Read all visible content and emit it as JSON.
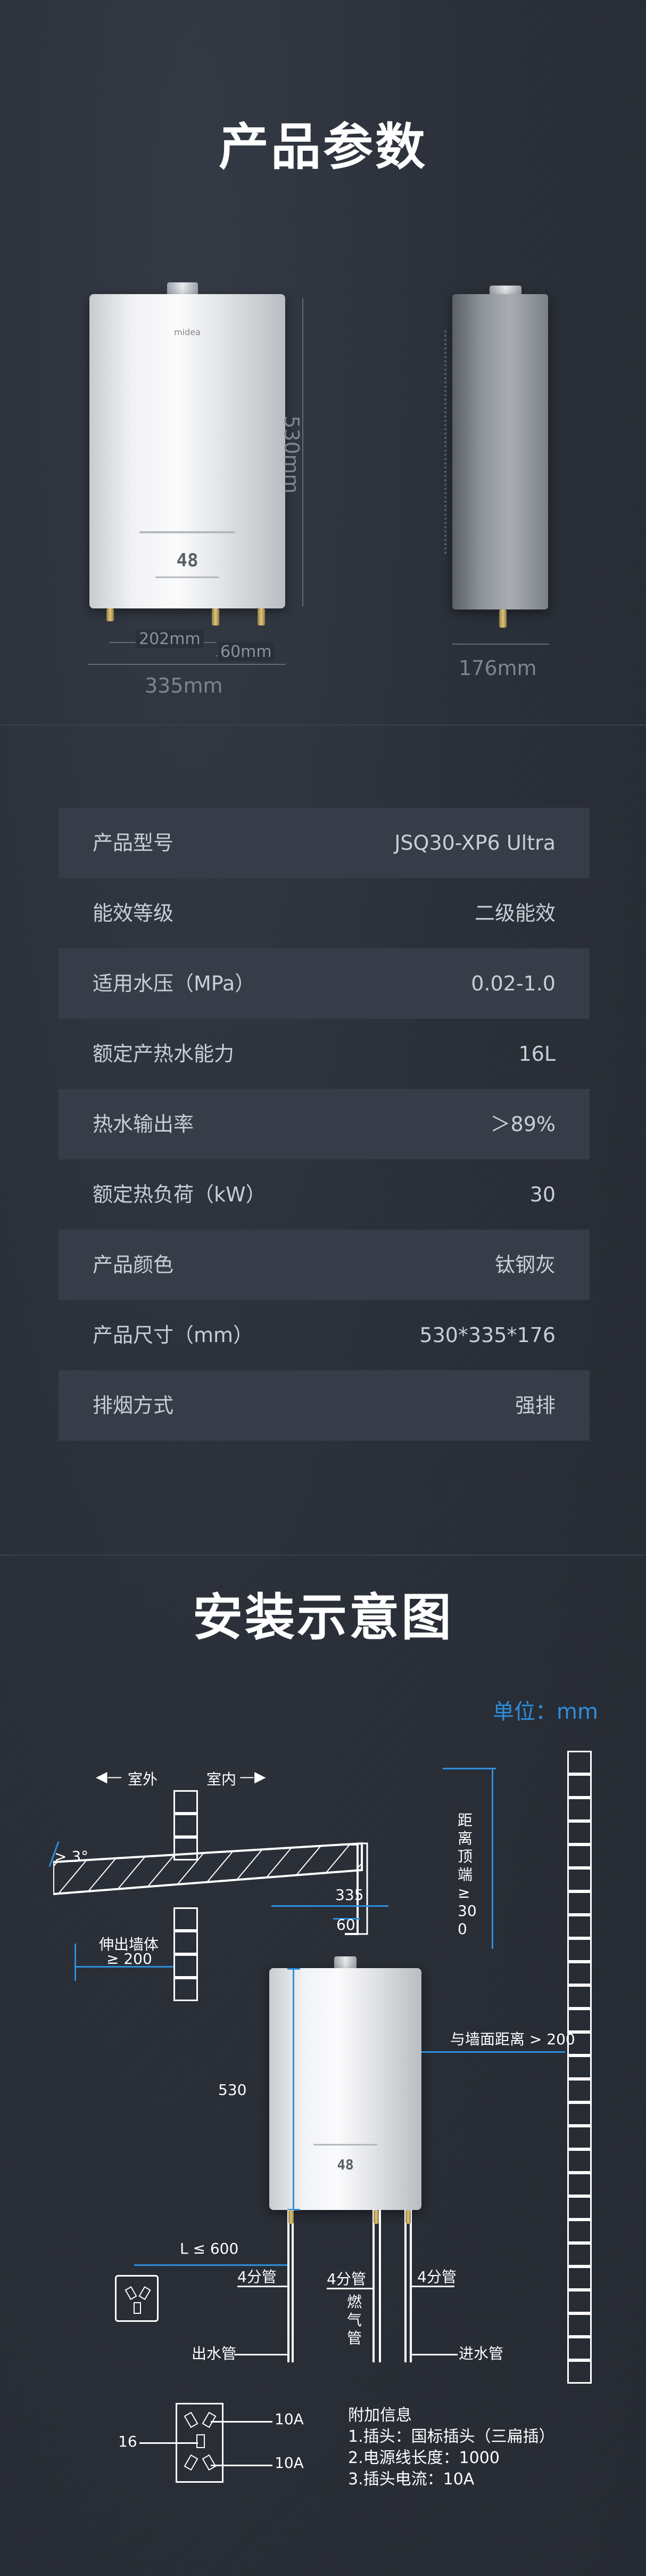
{
  "params_section": {
    "title": "产品参数",
    "dims": {
      "height": "530mm",
      "pipe_spacing": "202mm",
      "pipe_offset": "60mm",
      "width": "335mm",
      "depth": "176mm"
    },
    "heater_logo": "midea",
    "heater_display": "48"
  },
  "specs": [
    {
      "label": "产品型号",
      "value": "JSQ30-XP6 Ultra"
    },
    {
      "label": "能效等级",
      "value": "二级能效"
    },
    {
      "label": "适用水压（MPa）",
      "value": "0.02-1.0"
    },
    {
      "label": "额定产热水能力",
      "value": "16L"
    },
    {
      "label": "热水输出率",
      "value": "＞89%"
    },
    {
      "label": "额定热负荷（kW）",
      "value": "30"
    },
    {
      "label": "产品颜色",
      "value": "钛钢灰"
    },
    {
      "label": "产品尺寸（mm）",
      "value": "530*335*176"
    },
    {
      "label": "排烟方式",
      "value": "强排"
    }
  ],
  "install_section": {
    "title": "安装示意图",
    "unit": "单位：mm",
    "outdoor": "室外",
    "indoor": "室内",
    "slope": "> 3°",
    "extend_label": "伸出墙体",
    "extend_value": "≥ 200",
    "ceiling_distance": "距离顶端 ≥ 300",
    "dim_60": "60",
    "dim_335": "335",
    "dim_530": "530",
    "wall_distance": "与墙面距离 > 200",
    "socket_distance": "L ≤ 600",
    "pipe_left": "4分管",
    "pipe_middle": "4分管",
    "pipe_right": "4分管",
    "gas_pipe": "燃气管",
    "outlet": "出水管",
    "inlet": "进水管",
    "plug_16": "16",
    "plug_10a_top": "10A",
    "plug_10a_bottom": "10A",
    "extra_title": "附加信息",
    "extra_1": "1.插头：国标插头（三扁插）",
    "extra_2": "2.电源线长度：1000",
    "extra_3": "3.插头电流：10A"
  }
}
